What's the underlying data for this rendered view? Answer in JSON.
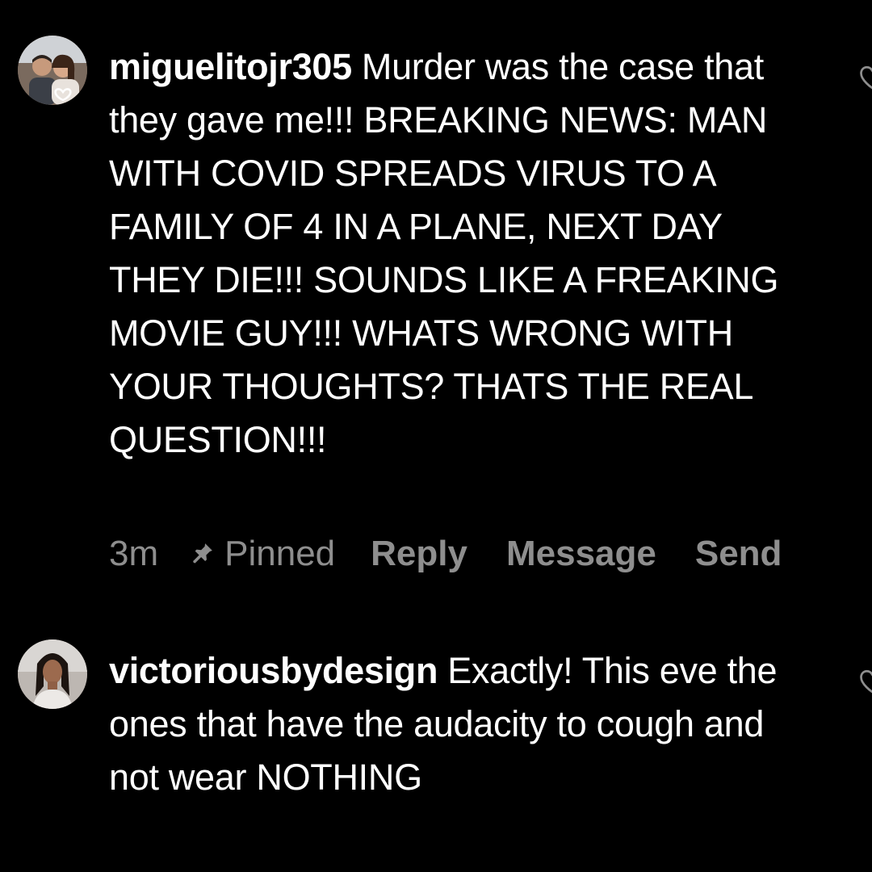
{
  "comments": [
    {
      "username": "miguelitojr305",
      "text": "Murder was the case that they gave me!!! BREAKING NEWS: MAN WITH COVID SPREADS VIRUS TO A FAMILY OF 4 IN A PLANE, NEXT DAY THEY DIE!!! SOUNDS LIKE A FREAKING MOVIE GUY!!! WHATS WRONG WITH YOUR THOUGHTS? THATS THE REAL QUESTION!!!",
      "time": "3m",
      "pinned_label": "Pinned",
      "actions": {
        "reply": "Reply",
        "message": "Message",
        "send": "Send"
      },
      "avatar_icon": "avatar-photo-couple"
    },
    {
      "username": "victoriousbydesign",
      "text": "Exactly! This eve the ones that have the audacity to cough and not wear NOTHING",
      "avatar_icon": "avatar-photo-woman"
    }
  ],
  "icons": {
    "pin": "pin-icon",
    "like": "heart-outline-icon"
  },
  "colors": {
    "background": "#000000",
    "text": "#ffffff",
    "meta_text": "#8e8e8e"
  }
}
